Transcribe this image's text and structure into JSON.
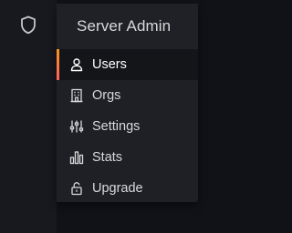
{
  "colors": {
    "accent_gradient_start": "#f7941d",
    "accent_gradient_end": "#ff5f5f",
    "text": "#d8d9da",
    "active_text": "#ffffff"
  },
  "sidebar": {
    "icon": "shield-icon"
  },
  "menu": {
    "header": "Server Admin",
    "items": [
      {
        "label": "Users",
        "icon": "user-icon",
        "active": true
      },
      {
        "label": "Orgs",
        "icon": "building-icon",
        "active": false
      },
      {
        "label": "Settings",
        "icon": "sliders-icon",
        "active": false
      },
      {
        "label": "Stats",
        "icon": "bar-chart-icon",
        "active": false
      },
      {
        "label": "Upgrade",
        "icon": "unlock-icon",
        "active": false
      }
    ]
  }
}
